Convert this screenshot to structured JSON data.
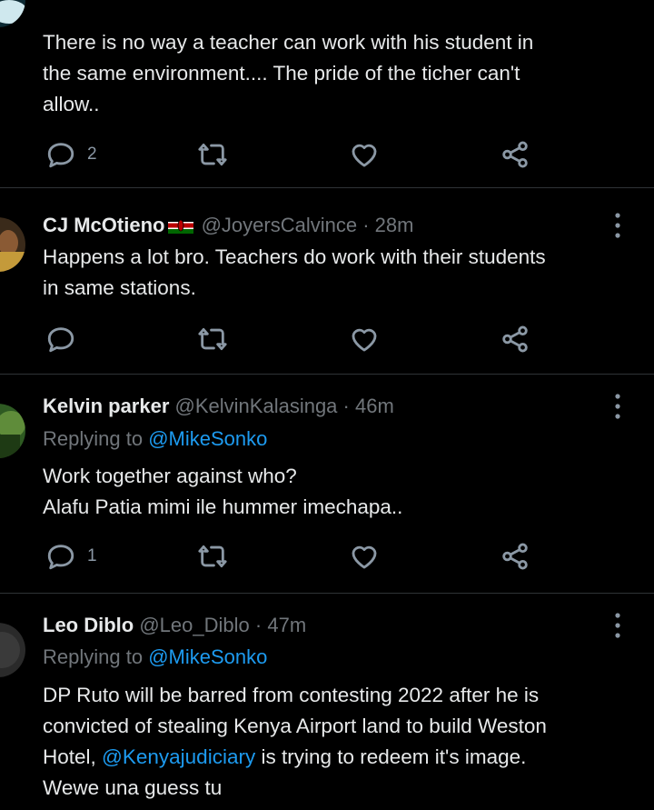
{
  "tweets": [
    {
      "body_lines": [
        "There is no way a teacher can work with his student in",
        "the same environment.... The pride of the ticher can't",
        "allow.."
      ],
      "actions": {
        "reply_count": "2",
        "retweet_count": "",
        "like_count": ""
      }
    },
    {
      "name": "CJ McOtieno",
      "flag": "kenya-flag-emoji",
      "handle": "@JoyersCalvince",
      "separator": "·",
      "time": "28m",
      "body_lines": [
        "Happens a lot bro. Teachers do work with their students",
        "in same stations."
      ],
      "actions": {
        "reply_count": "",
        "retweet_count": "",
        "like_count": ""
      }
    },
    {
      "name": "Kelvin parker",
      "handle": "@KelvinKalasinga",
      "separator": "·",
      "time": "46m",
      "replying_prefix": "Replying to",
      "replying_to": "@MikeSonko",
      "body_lines": [
        "Work together against who?",
        "Alafu Patia mimi ile hummer imechapa.."
      ],
      "actions": {
        "reply_count": "1",
        "retweet_count": "",
        "like_count": ""
      }
    },
    {
      "name": "Leo Diblo",
      "handle": "@Leo_Diblo",
      "separator": "·",
      "time": "47m",
      "replying_prefix": "Replying to",
      "replying_to": "@MikeSonko",
      "body_line1": "DP Ruto will be barred from contesting 2022 after he is",
      "body_line2": "convicted of stealing Kenya Airport land to build Weston",
      "body_line3_prefix": "Hotel, ",
      "body_line3_mention": "@Kenyajudiciary",
      "body_line3_suffix": " is trying to redeem it's image.",
      "body_line4": "Wewe una guess tu"
    }
  ],
  "icons": {
    "reply": "reply-bubble-icon",
    "retweet": "retweet-icon",
    "like": "heart-icon",
    "share": "share-icon",
    "more": "more-vertical-icon"
  },
  "colors": {
    "background": "#000000",
    "text": "#e7e9ea",
    "muted": "#71767b",
    "link": "#1d9bf0",
    "divider": "#2f3336"
  }
}
